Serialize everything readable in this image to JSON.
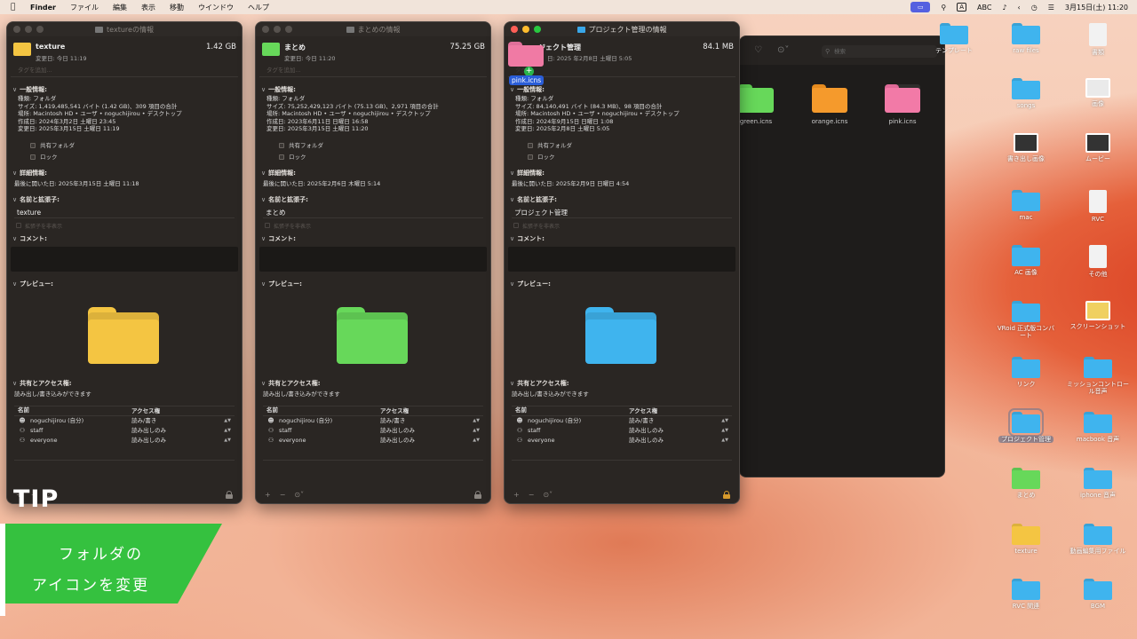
{
  "menubar": {
    "app_name": "Finder",
    "menus": [
      "ファイル",
      "編集",
      "表示",
      "移動",
      "ウインドウ",
      "ヘルプ"
    ],
    "ime_label": "A",
    "input_mode": "ABC",
    "datetime": "3月15日(土) 11:20"
  },
  "windows": [
    {
      "title": "textureの情報",
      "name": "texture",
      "size": "1.42 GB",
      "modified_short": "変更日: 今日 11:19",
      "folder_color": "#f4c542",
      "tags_placeholder": "タグを追加...",
      "general_header": "一般情報:",
      "kind": "種類: フォルダ",
      "size_detail": "サイズ: 1,419,485,541 バイト (1.42 GB)、309 項目の合計",
      "where": "場所: Macintosh HD • ユーザ • noguchijirou • デスクトップ",
      "created": "作成日: 2024年3月2日 土曜日 23:45",
      "modified": "変更日: 2025年3月15日 土曜日 11:19",
      "shared_label": "共有フォルダ",
      "locked_label": "ロック",
      "more_info_header": "詳細情報:",
      "last_opened": "最後に開いた日: 2025年3月15日 土曜日 11:18",
      "name_ext_header": "名前と拡張子:",
      "name_value": "texture",
      "hide_ext_label": "拡張子を非表示",
      "comments_header": "コメント:",
      "preview_header": "プレビュー:",
      "sharing_header": "共有とアクセス権:",
      "sharing_text": "読み出し/書き込みができます",
      "col_name": "名前",
      "col_access": "アクセス権",
      "permissions": [
        {
          "name": "noguchijirou (自分)",
          "access": "読み/書き"
        },
        {
          "name": "staff",
          "access": "読み出しのみ"
        },
        {
          "name": "everyone",
          "access": "読み出しのみ"
        }
      ]
    },
    {
      "title": "まとめの情報",
      "name": "まとめ",
      "size": "75.25 GB",
      "modified_short": "変更日: 今日 11:20",
      "folder_color": "#67d85a",
      "tags_placeholder": "タグを追加...",
      "general_header": "一般情報:",
      "kind": "種類: フォルダ",
      "size_detail": "サイズ: 75,252,429,123 バイト (75.13 GB)、2,971 項目の合計",
      "where": "場所: Macintosh HD • ユーザ • noguchijirou • デスクトップ",
      "created": "作成日: 2023年6月11日 日曜日 16:58",
      "modified": "変更日: 2025年3月15日 土曜日 11:20",
      "shared_label": "共有フォルダ",
      "locked_label": "ロック",
      "more_info_header": "詳細情報:",
      "last_opened": "最後に開いた日: 2025年2月6日 木曜日 5:14",
      "name_ext_header": "名前と拡張子:",
      "name_value": "まとめ",
      "hide_ext_label": "拡張子を非表示",
      "comments_header": "コメント:",
      "preview_header": "プレビュー:",
      "sharing_header": "共有とアクセス権:",
      "sharing_text": "読み出し/書き込みができます",
      "col_name": "名前",
      "col_access": "アクセス権",
      "permissions": [
        {
          "name": "noguchijirou (自分)",
          "access": "読み/書き"
        },
        {
          "name": "staff",
          "access": "読み出しのみ"
        },
        {
          "name": "everyone",
          "access": "読み出しのみ"
        }
      ]
    },
    {
      "title": "プロジェクト管理の情報",
      "name": "ジェクト管理",
      "size": "84.1 MB",
      "modified_short": "日: 2025 年2月8日 土曜日 5:05",
      "folder_color": "#3fb4ee",
      "tags_placeholder": "タグ",
      "general_header": "一般情報:",
      "kind": "種類: フォルダ",
      "size_detail": "サイズ: 84,140,491 バイト (84.3 MB)、98 項目の合計",
      "where": "場所: Macintosh HD • ユーザ • noguchijirou • デスクトップ",
      "created": "作成日: 2024年9月15日 日曜日 1:08",
      "modified": "変更日: 2025年2月8日 土曜日 5:05",
      "shared_label": "共有フォルダ",
      "locked_label": "ロック",
      "more_info_header": "詳細情報:",
      "last_opened": "最後に開いた日: 2025年2月9日 日曜日 4:54",
      "name_ext_header": "名前と拡張子:",
      "name_value": "プロジェクト管理",
      "hide_ext_label": "拡張子を非表示",
      "comments_header": "コメント:",
      "preview_header": "プレビュー:",
      "sharing_header": "共有とアクセス権:",
      "sharing_text": "読み出し/書き込みができます",
      "col_name": "名前",
      "col_access": "アクセス権",
      "permissions": [
        {
          "name": "noguchijirou (自分)",
          "access": "読み/書き"
        },
        {
          "name": "staff",
          "access": "読み出しのみ"
        },
        {
          "name": "everyone",
          "access": "読み出しのみ"
        }
      ]
    }
  ],
  "drag": {
    "label": "pink.icns",
    "plus": "+"
  },
  "finder": {
    "search_placeholder": "検索",
    "files": [
      {
        "name": "green.icns",
        "color": "#67d85a"
      },
      {
        "name": "orange.icns",
        "color": "#f59a2c"
      },
      {
        "name": "pink.icns",
        "color": "#f27aa7"
      }
    ]
  },
  "desktop": {
    "icons": [
      {
        "label": "テンプレート",
        "kind": "folder",
        "color": "#3fb4ee"
      },
      {
        "label": "raw files",
        "kind": "folder",
        "color": "#3fb4ee"
      },
      {
        "label": "書類",
        "kind": "doc",
        "color": "#f2f2f2"
      },
      {
        "label": "songs",
        "kind": "folder",
        "color": "#3fb4ee"
      },
      {
        "label": "画像",
        "kind": "img",
        "color": "#eaeaea"
      },
      {
        "label": "書き出し画像",
        "kind": "img",
        "color": "#333333"
      },
      {
        "label": "ムービー",
        "kind": "img",
        "color": "#333333"
      },
      {
        "label": "mac",
        "kind": "folder",
        "color": "#3fb4ee"
      },
      {
        "label": "RVC",
        "kind": "doc",
        "color": "#f2f2f2"
      },
      {
        "label": "AC 画像",
        "kind": "folder",
        "color": "#3fb4ee"
      },
      {
        "label": "その他",
        "kind": "doc",
        "color": "#f2f2f2"
      },
      {
        "label": "VRoid 正式版コンバート",
        "kind": "folder",
        "color": "#3fb4ee"
      },
      {
        "label": "スクリーンショット",
        "kind": "img",
        "color": "#f0d060"
      },
      {
        "label": "リンク",
        "kind": "folder",
        "color": "#3fb4ee"
      },
      {
        "label": "ミッションコントロール音声",
        "kind": "folder",
        "color": "#3fb4ee"
      },
      {
        "label": "プロジェクト管理",
        "kind": "folder",
        "color": "#3fb4ee"
      },
      {
        "label": "macbook 音声",
        "kind": "folder",
        "color": "#3fb4ee"
      },
      {
        "label": "まとめ",
        "kind": "folder",
        "color": "#67d85a"
      },
      {
        "label": "iphone 音声",
        "kind": "folder",
        "color": "#3fb4ee"
      },
      {
        "label": "texture",
        "kind": "folder",
        "color": "#f4c542"
      },
      {
        "label": "動画編集用ファイル",
        "kind": "folder",
        "color": "#3fb4ee"
      },
      {
        "label": "RVC 関連",
        "kind": "folder",
        "color": "#3fb4ee"
      },
      {
        "label": "BGM",
        "kind": "folder",
        "color": "#3fb4ee"
      }
    ]
  },
  "overlay": {
    "tip": "TIP",
    "line1": "フォルダの",
    "line2": "アイコンを変更"
  }
}
